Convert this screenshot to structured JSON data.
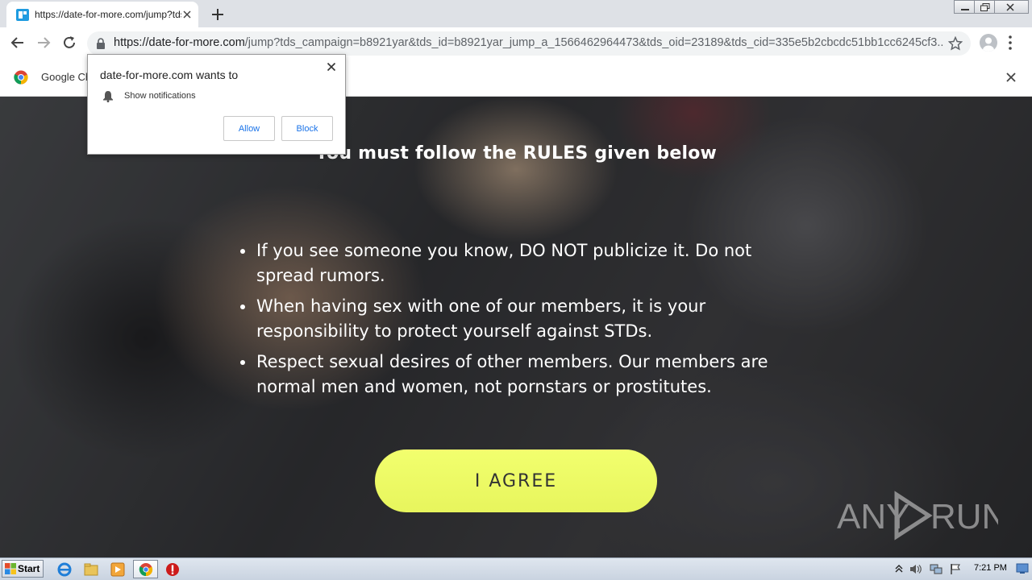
{
  "browser": {
    "tab_title": "https://date-for-more.com/jump?tds",
    "url_host": "https://date-for-more.com",
    "url_path": "/jump?tds_campaign=b8921yar&tds_id=b8921yar_jump_a_1566462964473&tds_oid=23189&tds_cid=335e5b2cbcdc51bb1cc6245cf3...",
    "infobar_text": "Google Ch"
  },
  "permission_popup": {
    "title": "date-for-more.com wants to",
    "item": "Show notifications",
    "allow_label": "Allow",
    "block_label": "Block"
  },
  "page": {
    "title": "You must follow the RULES given below",
    "rules": [
      "If you see someone you know, DO NOT publicize it. Do not spread rumors.",
      "When having sex with one of our members, it is your responsibility to protect yourself against STDs.",
      "Respect sexual desires of other members. Our members are normal men and women, not pornstars or prostitutes."
    ],
    "agree_label": "I AGREE",
    "watermark": "ANY RUN"
  },
  "taskbar": {
    "start_label": "Start",
    "clock": "7:21 PM"
  },
  "colors": {
    "agree_button": "#f2ff6e",
    "tab_favicon": "#1e9be0"
  }
}
